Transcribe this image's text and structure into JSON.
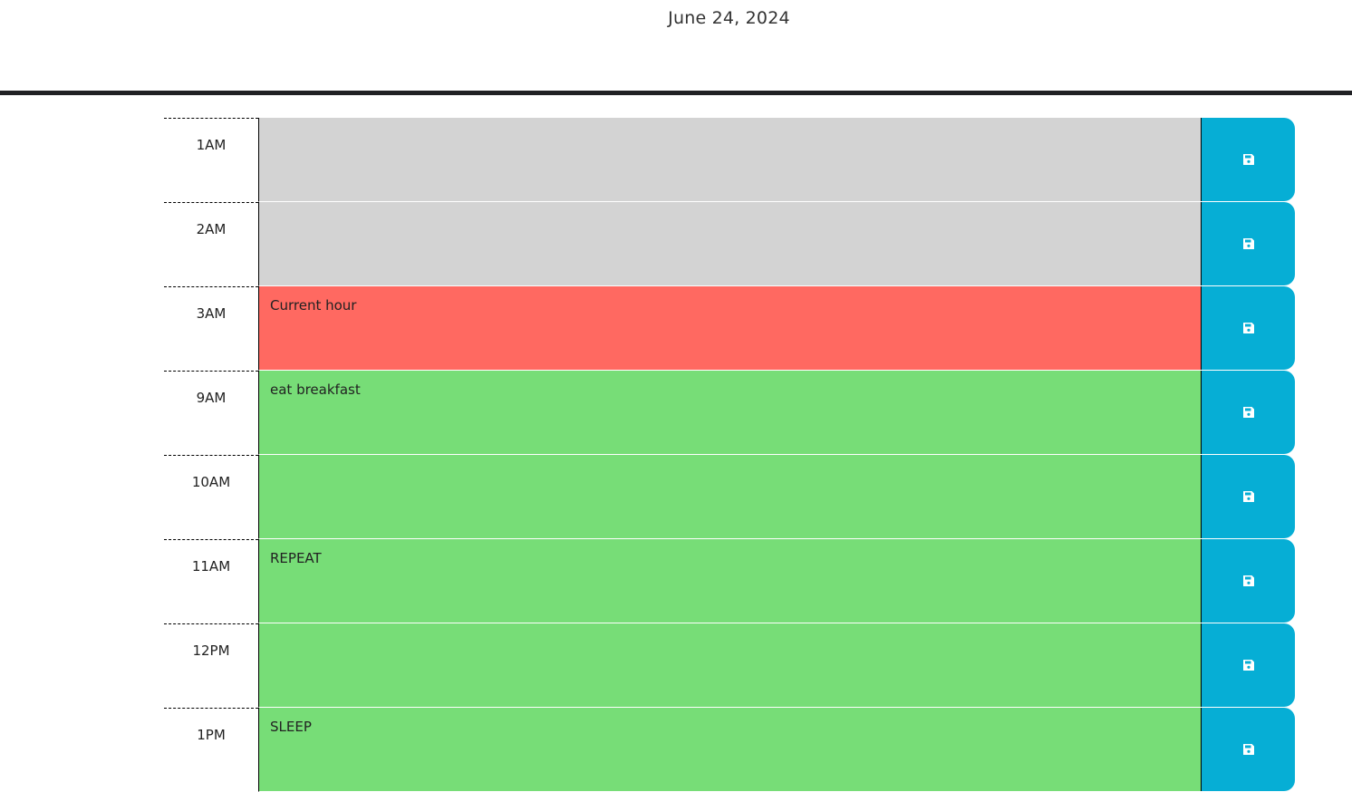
{
  "header": {
    "current_date": "June 24, 2024"
  },
  "colors": {
    "past": "#d3d3d3",
    "present": "#ff6961",
    "future": "#77dd77",
    "save_button": "#06aed5"
  },
  "time_blocks": [
    {
      "hour": "1AM",
      "state": "past",
      "text": "",
      "save_icon": "save-icon"
    },
    {
      "hour": "2AM",
      "state": "past",
      "text": "",
      "save_icon": "save-icon"
    },
    {
      "hour": "3AM",
      "state": "present",
      "text": "Current hour",
      "save_icon": "save-icon"
    },
    {
      "hour": "9AM",
      "state": "future",
      "text": "eat breakfast",
      "save_icon": "save-icon"
    },
    {
      "hour": "10AM",
      "state": "future",
      "text": "",
      "save_icon": "save-icon"
    },
    {
      "hour": "11AM",
      "state": "future",
      "text": "REPEAT",
      "save_icon": "save-icon"
    },
    {
      "hour": "12PM",
      "state": "future",
      "text": "",
      "save_icon": "save-icon"
    },
    {
      "hour": "1PM",
      "state": "future",
      "text": "SLEEP",
      "save_icon": "save-icon"
    }
  ]
}
